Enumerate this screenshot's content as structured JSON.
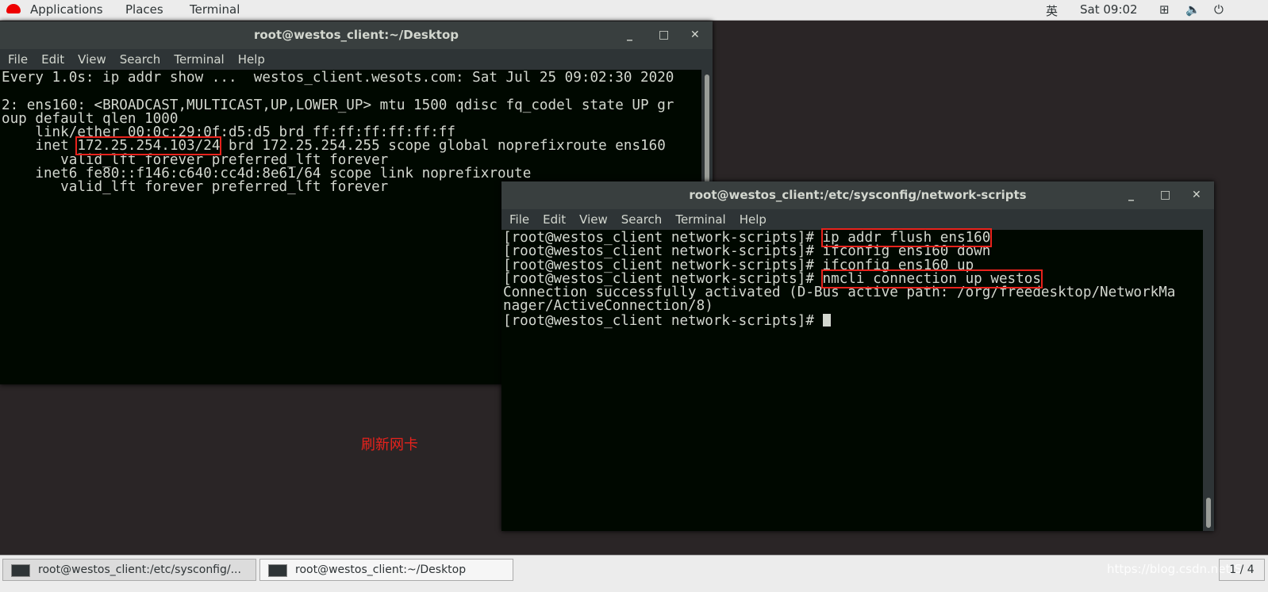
{
  "topbar": {
    "applications": "Applications",
    "places": "Places",
    "terminal": "Terminal",
    "input_method": "英",
    "clock": "Sat 09:02"
  },
  "term1": {
    "title": "root@westos_client:~/Desktop",
    "menu": [
      "File",
      "Edit",
      "View",
      "Search",
      "Terminal",
      "Help"
    ],
    "lines": [
      "Every 1.0s: ip addr show ...  westos_client.wesots.com: Sat Jul 25 09:02:30 2020",
      "",
      "2: ens160: <BROADCAST,MULTICAST,UP,LOWER_UP> mtu 1500 qdisc fq_codel state UP gr",
      "oup default qlen 1000",
      "    link/ether 00:0c:29:0f:d5:d5 brd ff:ff:ff:ff:ff:ff"
    ],
    "inet_prefix": "    inet ",
    "inet_ip": "172.25.254.103/24",
    "inet_rest": " brd 172.25.254.255 scope global noprefixroute ens160",
    "lines2": [
      "       valid_lft forever preferred_lft forever",
      "    inet6 fe80::f146:c640:cc4d:8e61/64 scope link noprefixroute",
      "       valid_lft forever preferred_lft forever"
    ]
  },
  "term2": {
    "title": "root@westos_client:/etc/sysconfig/network-scripts",
    "menu": [
      "File",
      "Edit",
      "View",
      "Search",
      "Terminal",
      "Help"
    ],
    "prompt": "[root@westos_client network-scripts]# ",
    "cmd1": "ip addr flush ens160",
    "cmd2": "ifconfig ens160 down",
    "cmd3": "ifconfig ens160 up",
    "cmd4": "nmcli connection up westos",
    "out1": "Connection successfully activated (D-Bus active path: /org/freedesktop/NetworkMa",
    "out2": "nager/ActiveConnection/8)"
  },
  "annotation": "刷新网卡",
  "taskbar": {
    "tasks": [
      "root@westos_client:/etc/sysconfig/...",
      "root@westos_client:~/Desktop"
    ],
    "workspace": "1 / 4",
    "watermark": "https://blog.csdn.net/S"
  },
  "colors": {
    "highlight": "#e8221c",
    "terminal_bg": "#000800"
  }
}
